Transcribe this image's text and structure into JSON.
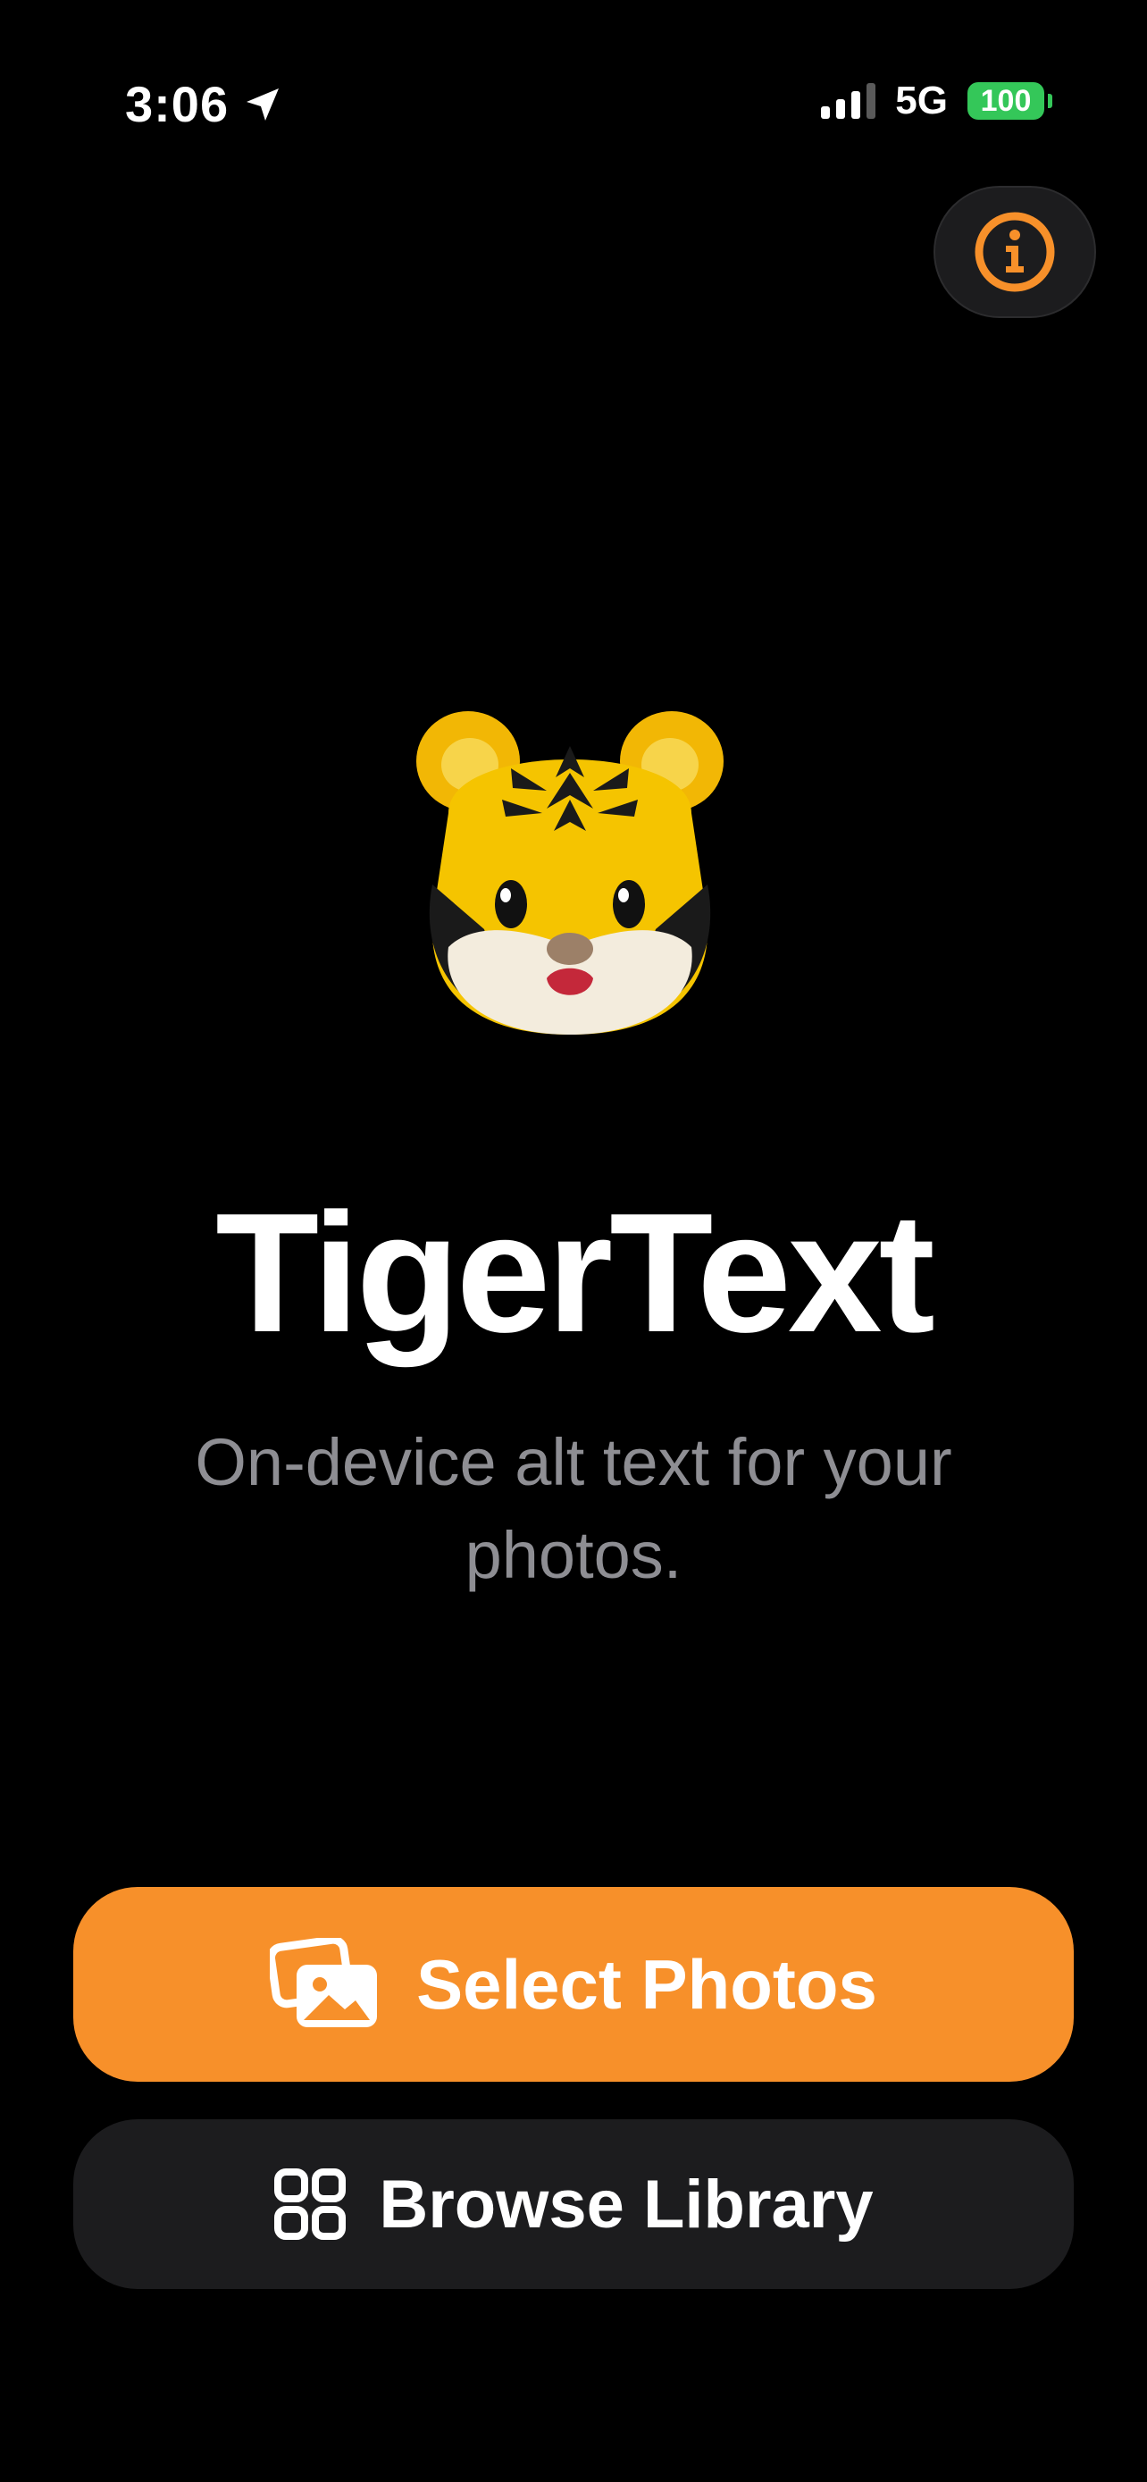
{
  "status_bar": {
    "time": "3:06",
    "network": "5G",
    "battery": "100",
    "icons": [
      "location-arrow-icon",
      "cellular-signal-icon",
      "battery-icon"
    ]
  },
  "header": {
    "info_icon": "info-circle-icon"
  },
  "hero": {
    "mascot": "tiger-face-emoji",
    "title": "TigerText",
    "subtitle": "On-device alt text for your photos."
  },
  "actions": {
    "select_photos": {
      "label": "Select Photos",
      "icon": "photo-stack-icon"
    },
    "browse_library": {
      "label": "Browse Library",
      "icon": "grid-icon"
    }
  },
  "colors": {
    "background": "#000000",
    "accent": "#f7902a",
    "secondary_button": "#1c1c1e",
    "subtitle": "#8e8e93",
    "battery": "#34c759"
  }
}
